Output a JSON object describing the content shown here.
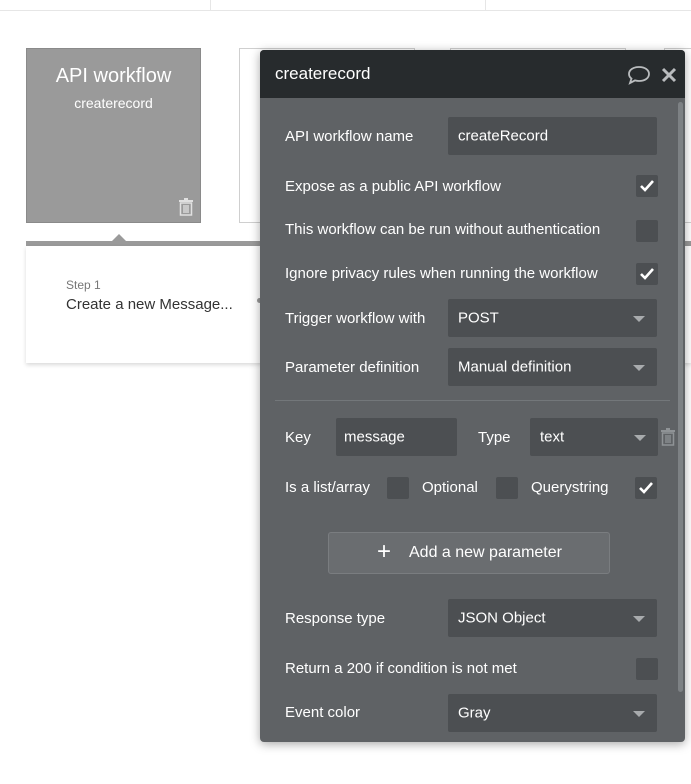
{
  "workflow_card": {
    "type_label": "API workflow",
    "name": "createrecord"
  },
  "step": {
    "number_label": "Step 1",
    "title": "Create a new Message..."
  },
  "editor": {
    "title": "createrecord",
    "fields": {
      "api_name": {
        "label": "API workflow name",
        "value": "createRecord"
      },
      "expose_public": {
        "label": "Expose as a public API workflow",
        "checked": true
      },
      "no_auth": {
        "label": "This workflow can be run without authentication",
        "checked": false
      },
      "ignore_privacy": {
        "label": "Ignore privacy rules when running the workflow",
        "checked": true
      },
      "trigger": {
        "label": "Trigger workflow with",
        "value": "POST"
      },
      "param_def": {
        "label": "Parameter definition",
        "value": "Manual definition"
      }
    },
    "parameter": {
      "key_label": "Key",
      "key_value": "message",
      "type_label": "Type",
      "type_value": "text",
      "is_list_label": "Is a list/array",
      "is_list_checked": false,
      "optional_label": "Optional",
      "optional_checked": false,
      "querystring_label": "Querystring",
      "querystring_checked": true
    },
    "add_parameter_label": "Add a new parameter",
    "response": {
      "label": "Response type",
      "value": "JSON Object"
    },
    "return_200": {
      "label": "Return a 200 if condition is not met",
      "checked": false
    },
    "event_color": {
      "label": "Event color",
      "value": "Gray"
    }
  },
  "icons": {
    "trash": "trash-icon",
    "comment": "comment-icon",
    "close": "close-icon",
    "check": "checkmark-icon",
    "plus": "plus-icon"
  }
}
